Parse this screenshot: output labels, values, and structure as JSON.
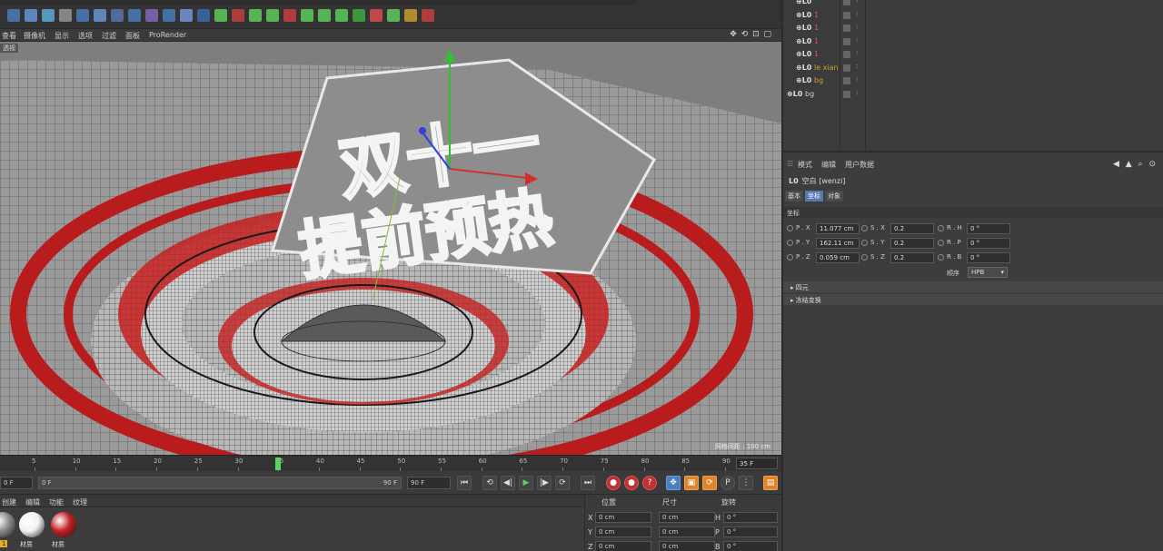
{
  "viewport": {
    "menu": [
      "查看",
      "摄像机",
      "显示",
      "选项",
      "过滤",
      "面板",
      "ProRender"
    ],
    "nav_icons": "✥ ⟲ ⊡ ▢",
    "label": "透视",
    "grid_spacing": "网格间距 : 100 cm",
    "title_line1": "双十一",
    "title_line2": "提前预热"
  },
  "timeline": {
    "ticks": [
      "5",
      "10",
      "15",
      "20",
      "25",
      "30",
      "35",
      "40",
      "45",
      "50",
      "55",
      "60",
      "65",
      "70",
      "75",
      "80",
      "85",
      "90"
    ],
    "current_frame_label": "35 F",
    "playhead_frame": 35
  },
  "transport": {
    "start_field": "0 F",
    "range_start": "0 F",
    "range_end": "90 F",
    "end_field": "90 F",
    "buttons": [
      "⏮",
      "⟲",
      "◀|",
      "▶",
      "|▶",
      "⟳",
      "⏭"
    ]
  },
  "materials": {
    "menu": [
      "创建",
      "编辑",
      "功能",
      "纹理"
    ],
    "items": [
      {
        "name": "1",
        "color": "#8a8a8a"
      },
      {
        "name": "材质",
        "color": "#f2f2f2"
      },
      {
        "name": "材质",
        "color": "#c21e1e"
      }
    ]
  },
  "coords": {
    "headers": [
      "位置",
      "尺寸",
      "旋转"
    ],
    "rows": [
      {
        "axis": "X",
        "pos": "0 cm",
        "size": "0 cm",
        "rot_axis": "H",
        "rot": "0 °"
      },
      {
        "axis": "Y",
        "pos": "0 cm",
        "size": "0 cm",
        "rot_axis": "P",
        "rot": "0 °"
      },
      {
        "axis": "Z",
        "pos": "0 cm",
        "size": "0 cm",
        "rot_axis": "B",
        "rot": "0 °"
      }
    ]
  },
  "objects": [
    {
      "name": "",
      "color": "#d0a030"
    },
    {
      "name": "1",
      "color": "#e05050"
    },
    {
      "name": "1",
      "color": "#e05050"
    },
    {
      "name": "1",
      "color": "#e05050"
    },
    {
      "name": "1",
      "color": "#e05050"
    },
    {
      "name": "le xian",
      "color": "#d0a030"
    },
    {
      "name": "bg",
      "color": "#d0a030"
    },
    {
      "name": "bg",
      "color": "#cfcfcf"
    }
  ],
  "attributes": {
    "menu": [
      "模式",
      "编辑",
      "用户数据"
    ],
    "nav_icons": "◀ ▲ ⌕ ⊙",
    "object_title": "空白 [wenzi]",
    "tabs": [
      "基本",
      "坐标",
      "对象"
    ],
    "active_tab": "坐标",
    "section": "坐标",
    "rows": [
      {
        "p_label": "P . X",
        "p_val": "11.077 cm",
        "s_label": "S . X",
        "s_val": "0.2",
        "r_label": "R . H",
        "r_val": "0 °"
      },
      {
        "p_label": "P . Y",
        "p_val": "162.11 cm",
        "s_label": "S . Y",
        "s_val": "0.2",
        "r_label": "R . P",
        "r_val": "0 °"
      },
      {
        "p_label": "P . Z",
        "p_val": "0.059 cm",
        "s_label": "S . Z",
        "s_val": "0.2",
        "r_label": "R . B",
        "r_val": "0 °"
      }
    ],
    "order_label": "顺序",
    "order_value": "HPB",
    "collapsed": [
      "四元",
      "冻结变换"
    ]
  }
}
